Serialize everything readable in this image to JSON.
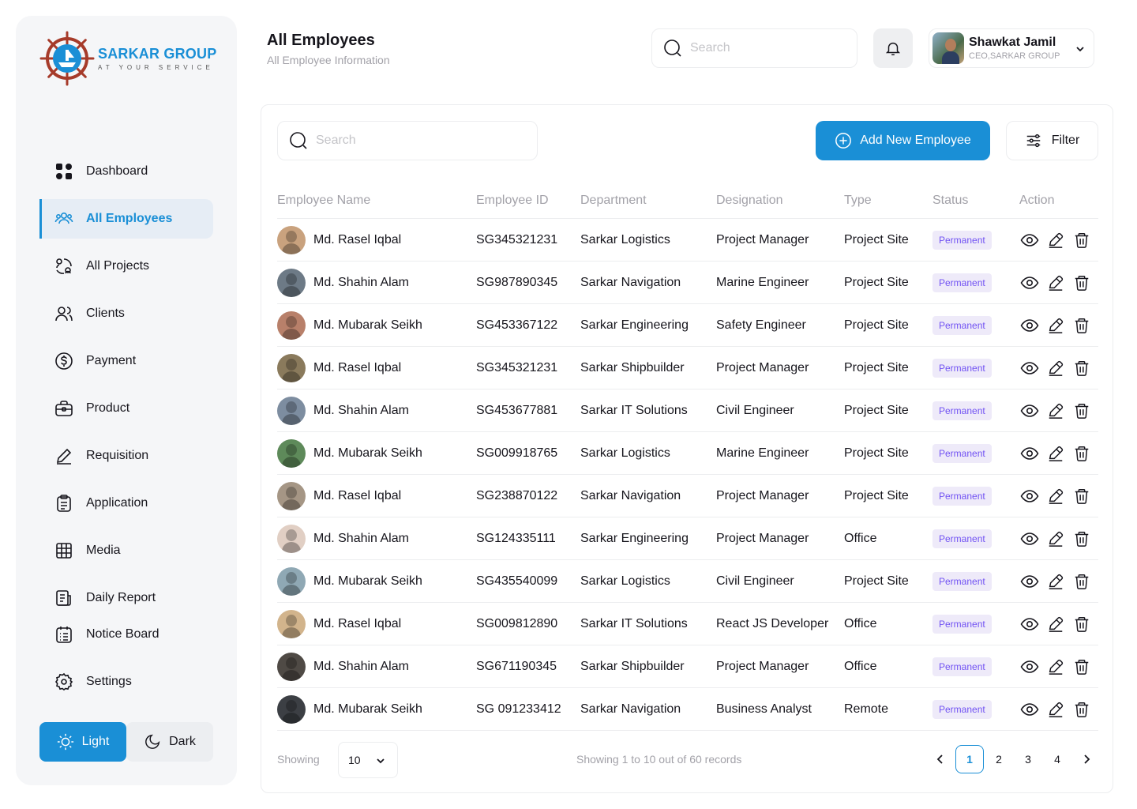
{
  "brand": {
    "name": "SARKAR GROUP",
    "tagline": "AT YOUR SERVICE",
    "colors": {
      "primary": "#1a8fd6",
      "logo_ring": "#a63b2a",
      "badge_bg": "#eeeaf9",
      "badge_text": "#7152f3"
    }
  },
  "sidebar": {
    "items": [
      {
        "label": "Dashboard",
        "icon": "dashboard-icon",
        "active": false
      },
      {
        "label": "All Employees",
        "icon": "users-icon",
        "active": true
      },
      {
        "label": "All Projects",
        "icon": "projects-icon",
        "active": false
      },
      {
        "label": "Clients",
        "icon": "clients-icon",
        "active": false
      },
      {
        "label": "Payment",
        "icon": "dollar-icon",
        "active": false
      },
      {
        "label": "Product",
        "icon": "briefcase-icon",
        "active": false
      },
      {
        "label": "Requisition",
        "icon": "pen-icon",
        "active": false
      },
      {
        "label": "Application",
        "icon": "clipboard-icon",
        "active": false
      },
      {
        "label": "Media",
        "icon": "grid-icon",
        "active": false
      },
      {
        "label": "Daily Report",
        "icon": "report-icon",
        "active": false
      }
    ],
    "bottom_items": [
      {
        "label": "Notice Board",
        "icon": "notice-icon"
      },
      {
        "label": "Settings",
        "icon": "gear-icon"
      }
    ],
    "theme": {
      "light_label": "Light",
      "dark_label": "Dark",
      "selected": "light"
    }
  },
  "header": {
    "title": "All Employees",
    "subtitle": "All Employee Information",
    "search_placeholder": "Search",
    "user": {
      "name": "Shawkat Jamil",
      "role": "CEO,SARKAR GROUP"
    }
  },
  "main": {
    "search_placeholder": "Search",
    "add_button_label": "Add New Employee",
    "filter_button_label": "Filter",
    "columns": [
      "Employee Name",
      "Employee ID",
      "Department",
      "Designation",
      "Type",
      "Status",
      "Action"
    ],
    "rows": [
      {
        "name": "Md. Rasel Iqbal",
        "id": "SG345321231",
        "department": "Sarkar Logistics",
        "designation": "Project Manager",
        "type": "Project Site",
        "status": "Permanent",
        "avatar_color": "#c9a27e"
      },
      {
        "name": "Md. Shahin Alam",
        "id": "SG987890345",
        "department": "Sarkar Navigation",
        "designation": "Marine Engineer",
        "type": "Project Site",
        "status": "Permanent",
        "avatar_color": "#6d7a86"
      },
      {
        "name": "Md. Mubarak Seikh",
        "id": "SG453367122",
        "department": "Sarkar Engineering",
        "designation": "Safety Engineer",
        "type": "Project Site",
        "status": "Permanent",
        "avatar_color": "#b8806a"
      },
      {
        "name": "Md. Rasel Iqbal",
        "id": "SG345321231",
        "department": "Sarkar Shipbuilder",
        "designation": "Project Manager",
        "type": "Project Site",
        "status": "Permanent",
        "avatar_color": "#8a7a5c"
      },
      {
        "name": "Md. Shahin Alam",
        "id": "SG453677881",
        "department": "Sarkar IT Solutions",
        "designation": "Civil Engineer",
        "type": "Project Site",
        "status": "Permanent",
        "avatar_color": "#7d8da0"
      },
      {
        "name": "Md. Mubarak Seikh",
        "id": "SG009918765",
        "department": "Sarkar Logistics",
        "designation": "Marine Engineer",
        "type": "Project Site",
        "status": "Permanent",
        "avatar_color": "#5e8a5a"
      },
      {
        "name": "Md. Rasel Iqbal",
        "id": "SG238870122",
        "department": "Sarkar Navigation",
        "designation": "Project Manager",
        "type": "Project Site",
        "status": "Permanent",
        "avatar_color": "#a59685"
      },
      {
        "name": "Md. Shahin Alam",
        "id": "SG124335111",
        "department": "Sarkar Engineering",
        "designation": "Project Manager",
        "type": "Office",
        "status": "Permanent",
        "avatar_color": "#e1cfc4"
      },
      {
        "name": "Md. Mubarak Seikh",
        "id": "SG435540099",
        "department": "Sarkar Logistics",
        "designation": "Civil Engineer",
        "type": "Project Site",
        "status": "Permanent",
        "avatar_color": "#8fa8b4"
      },
      {
        "name": "Md. Rasel Iqbal",
        "id": "SG009812890",
        "department": "Sarkar IT Solutions",
        "designation": "React JS Developer",
        "type": "Office",
        "status": "Permanent",
        "avatar_color": "#d2b48c"
      },
      {
        "name": "Md. Shahin Alam",
        "id": "SG671190345",
        "department": "Sarkar Shipbuilder",
        "designation": "Project Manager",
        "type": "Office",
        "status": "Permanent",
        "avatar_color": "#4f4a45"
      },
      {
        "name": "Md. Mubarak Seikh",
        "id": "SG 091233412",
        "department": "Sarkar Navigation",
        "designation": "Business Analyst",
        "type": "Remote",
        "status": "Permanent",
        "avatar_color": "#3c3f44"
      }
    ]
  },
  "footer": {
    "showing_label": "Showing",
    "per_page": "10",
    "records_text": "Showing 1 to 10 out of 60 records",
    "pages": [
      "1",
      "2",
      "3",
      "4"
    ],
    "current_page": "1"
  }
}
